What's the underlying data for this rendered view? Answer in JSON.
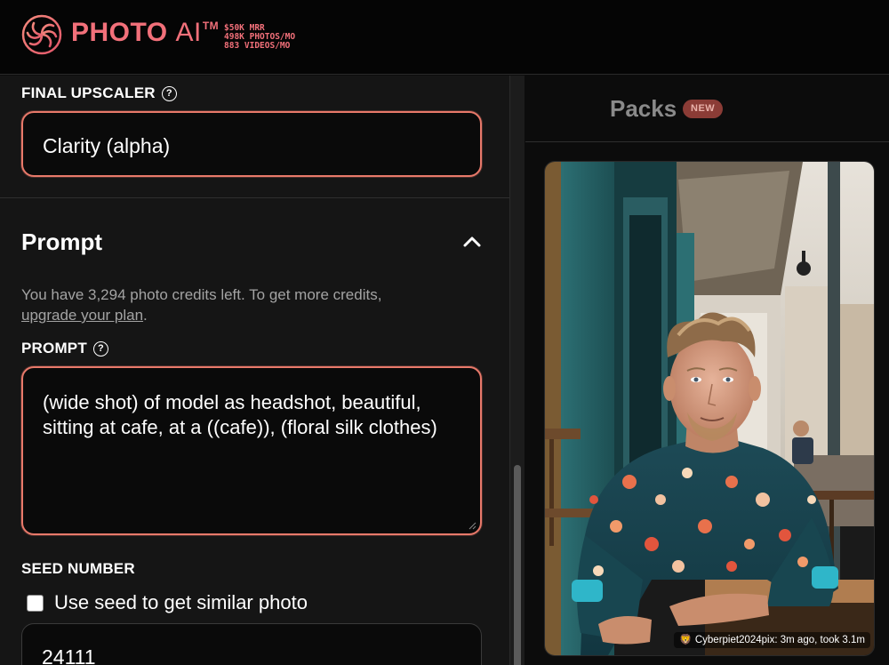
{
  "header": {
    "logo_name": "PHOTO",
    "logo_ai": "AI",
    "logo_tm": "TM",
    "stats": [
      "$50K MRR",
      "498K PHOTOS/MO",
      "883 VIDEOS/MO"
    ],
    "brand_color": "#f2707a",
    "logo_icon": "swirl-logo-icon"
  },
  "left_panel": {
    "upscaler": {
      "label": "FINAL UPSCALER",
      "value": "Clarity (alpha)",
      "help_icon": "question-circle-icon"
    },
    "prompt_section": {
      "title": "Prompt",
      "collapse_icon": "chevron-up-icon",
      "credits_text": "You have 3,294 photo credits left. To get more credits,",
      "upgrade_link": "upgrade your plan",
      "credits_period": ".",
      "prompt_label": "PROMPT",
      "prompt_value": "(wide shot) of model as headshot, beautiful, sitting at cafe, at a ((cafe)), (floral silk clothes)",
      "seed_label": "SEED NUMBER",
      "seed_checkbox_label": "Use seed to get similar photo",
      "seed_checked": false,
      "seed_value": "24111"
    },
    "accent_color": "#e8796a"
  },
  "right_panel": {
    "tab_label": "Packs",
    "badge": "NEW",
    "photo": {
      "caption_emoji": "🦁",
      "caption": "Cyberpiet2024pix: 3m ago, took 3.1m"
    }
  }
}
